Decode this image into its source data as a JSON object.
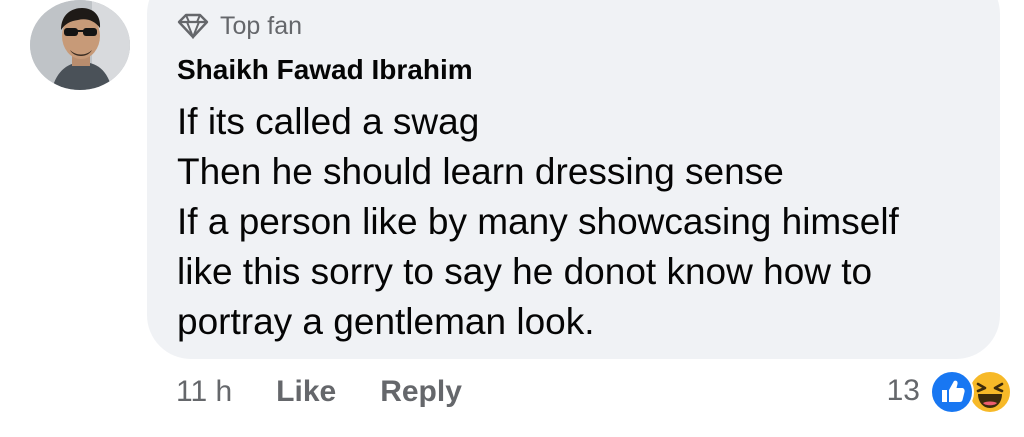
{
  "comment": {
    "badge": {
      "icon": "diamond-icon",
      "label": "Top fan"
    },
    "author": "Shaikh Fawad Ibrahim",
    "lines": [
      "If its called a swag",
      "Then he should learn dressing sense",
      "If a person like by many showcasing himself",
      "like this sorry to say he donot know how to",
      "portray a gentleman look."
    ],
    "timestamp": "11 h",
    "like_label": "Like",
    "reply_label": "Reply",
    "reactions": {
      "count": "13",
      "types": [
        "like",
        "haha"
      ]
    }
  },
  "colors": {
    "bubble": "#f0f2f5",
    "text": "#050505",
    "secondary": "#65676b",
    "like_blue": "#1877f2",
    "haha_yellow": "#f7b928"
  }
}
